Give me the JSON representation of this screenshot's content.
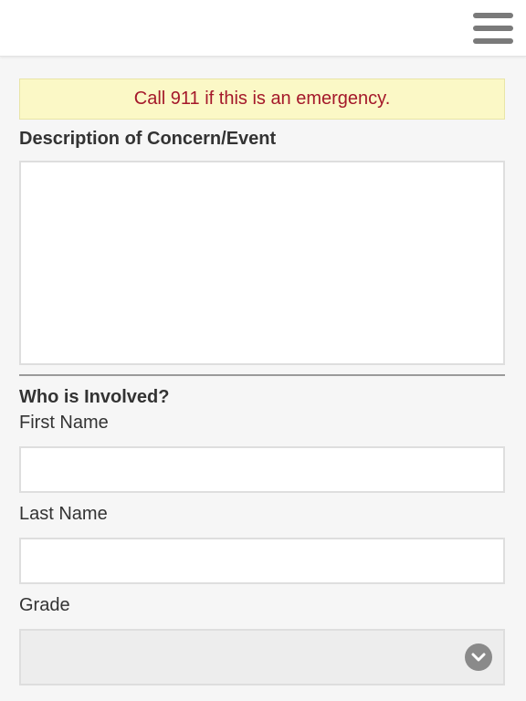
{
  "header": {
    "menu_icon": "hamburger-menu-icon"
  },
  "alert": {
    "text": "Call 911 if this is an emergency."
  },
  "form": {
    "description_label": "Description of Concern/Event",
    "description_value": "",
    "involved_heading": "Who is Involved?",
    "first_name_label": "First Name",
    "first_name_value": "",
    "last_name_label": "Last Name",
    "last_name_value": "",
    "grade_label": "Grade",
    "grade_value": ""
  },
  "colors": {
    "alert_bg": "#fbf8c6",
    "alert_text": "#a4182a",
    "page_bg": "#f6f6f6",
    "icon_gray": "#7a7a7a"
  }
}
